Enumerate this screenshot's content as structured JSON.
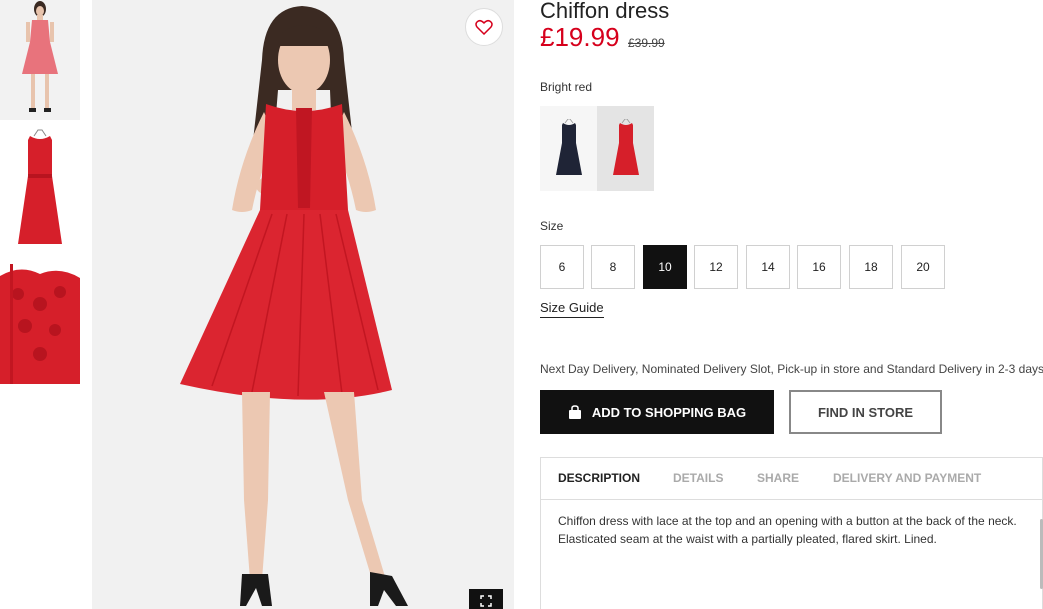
{
  "product": {
    "title": "Chiffon dress",
    "price": "£19.99",
    "old_price": "£39.99",
    "color_name": "Bright red"
  },
  "colors": {
    "accent_red": "#d6001c",
    "dress_red": "#d61f2a",
    "dark_navy": "#1f2436",
    "button_black": "#111111"
  },
  "swatches": [
    {
      "name": "dark-blue",
      "icon": "dress-dark-icon",
      "selected": false
    },
    {
      "name": "bright-red",
      "icon": "dress-red-icon",
      "selected": true
    }
  ],
  "size": {
    "label": "Size",
    "options": [
      "6",
      "8",
      "10",
      "12",
      "14",
      "16",
      "18",
      "20"
    ],
    "selected": "10",
    "guide_label": "Size Guide"
  },
  "delivery_text": "Next Day Delivery, Nominated Delivery Slot, Pick-up in store and Standard Delivery in 2-3 days.",
  "buttons": {
    "add_to_bag": "ADD TO SHOPPING BAG",
    "find_in_store": "FIND IN STORE"
  },
  "tabs": [
    {
      "label": "DESCRIPTION",
      "active": true
    },
    {
      "label": "DETAILS",
      "active": false
    },
    {
      "label": "SHARE",
      "active": false
    },
    {
      "label": "DELIVERY AND PAYMENT",
      "active": false
    }
  ],
  "description": "Chiffon dress with lace at the top and an opening with a button at the back of the neck. Elasticated seam at the waist with a partially pleated, flared skirt. Lined.",
  "icons": {
    "favorite": "heart-icon",
    "expand": "expand-icon",
    "bag": "shopping-bag-icon"
  }
}
